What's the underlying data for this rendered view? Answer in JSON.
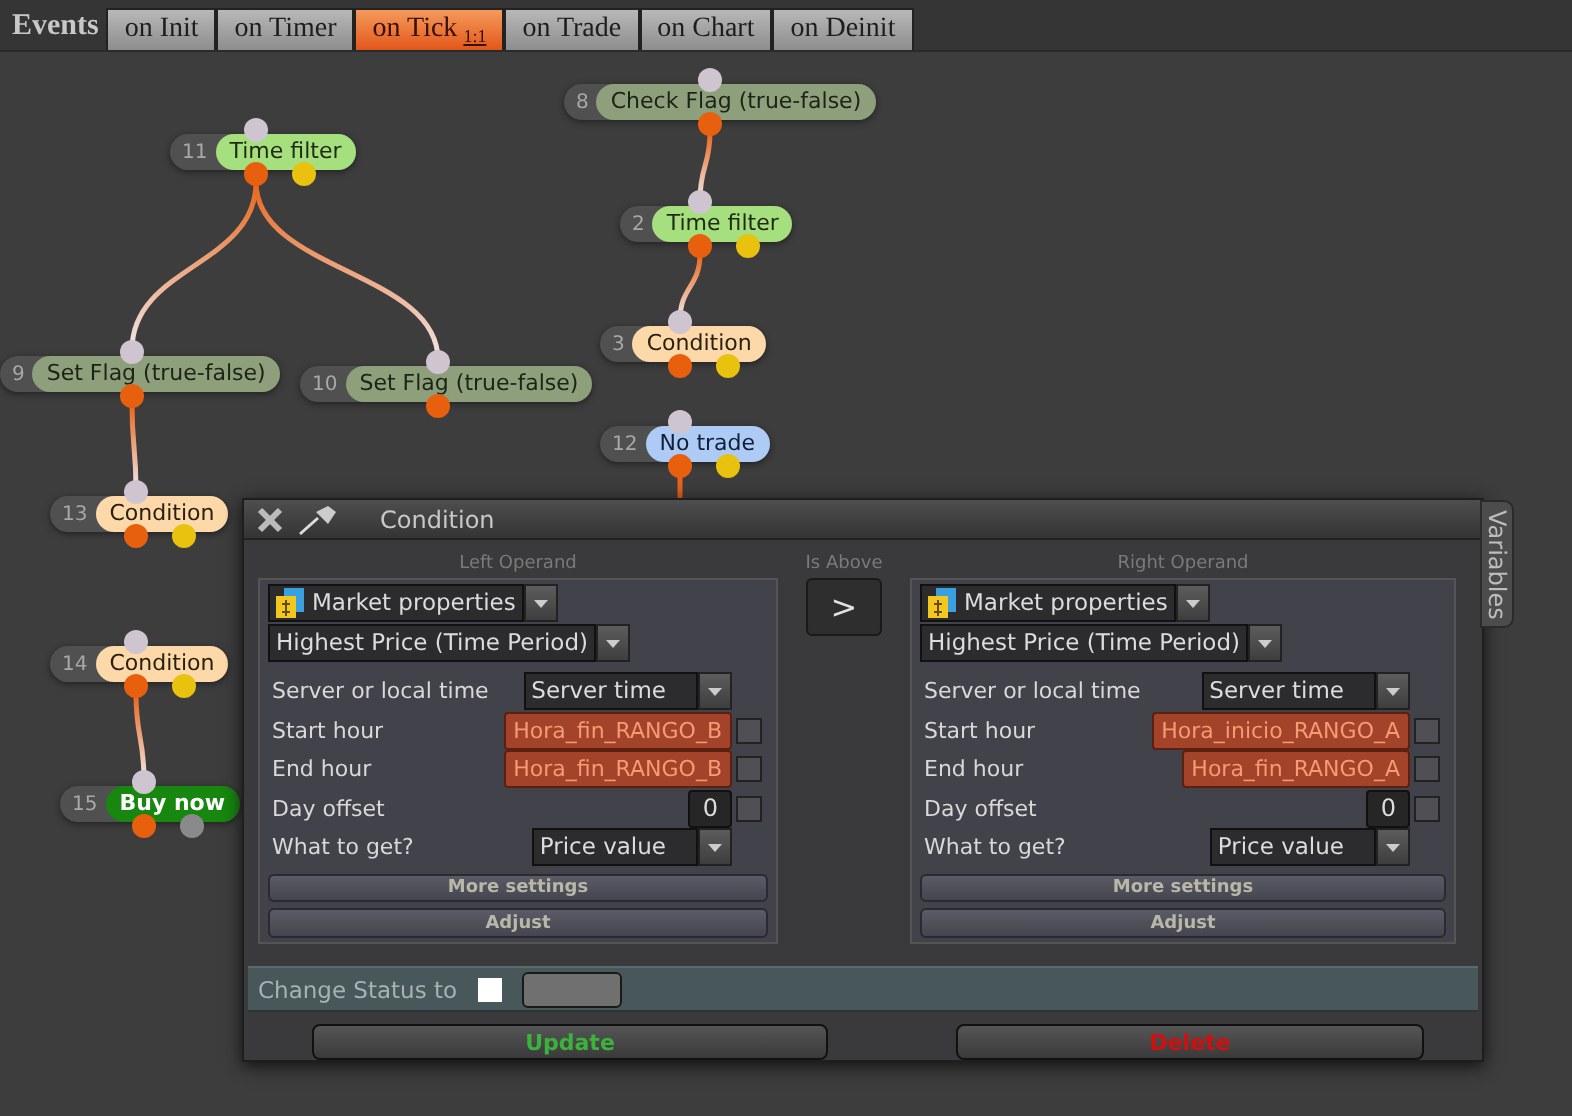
{
  "events": {
    "label": "Events",
    "tabs": [
      {
        "label": "on Init",
        "selected": false
      },
      {
        "label": "on Timer",
        "selected": false
      },
      {
        "label": "on Tick",
        "selected": true,
        "badge": "1:1"
      },
      {
        "label": "on Trade",
        "selected": false
      },
      {
        "label": "on Chart",
        "selected": false
      },
      {
        "label": "on Deinit",
        "selected": false
      }
    ]
  },
  "nodes": [
    {
      "number": "11",
      "label": "Time filter",
      "kind": "filter"
    },
    {
      "number": "8",
      "label": "Check Flag (true-false)",
      "kind": "flag"
    },
    {
      "number": "2",
      "label": "Time filter",
      "kind": "filter"
    },
    {
      "number": "3",
      "label": "Condition",
      "kind": "condition"
    },
    {
      "number": "12",
      "label": "No trade",
      "kind": "notrade"
    },
    {
      "number": "9",
      "label": "Set Flag (true-false)",
      "kind": "flag"
    },
    {
      "number": "10",
      "label": "Set Flag (true-false)",
      "kind": "flag"
    },
    {
      "number": "13",
      "label": "Condition",
      "kind": "condition"
    },
    {
      "number": "14",
      "label": "Condition",
      "kind": "condition"
    },
    {
      "number": "15",
      "label": "Buy now",
      "kind": "action"
    }
  ],
  "dialog": {
    "title": "Condition",
    "operator": {
      "caption": "Is Above",
      "symbol": ">"
    },
    "operands": [
      {
        "caption": "Left Operand",
        "category": "Market properties",
        "function": "Highest Price (Time Period)",
        "params": [
          {
            "label": "Server or local time",
            "kind": "select",
            "value": "Server time"
          },
          {
            "label": "Start hour",
            "kind": "variable",
            "value": "Hora_fin_RANGO_B",
            "checked": false
          },
          {
            "label": "End hour",
            "kind": "variable",
            "value": "Hora_fin_RANGO_B",
            "checked": false
          },
          {
            "label": "Day offset",
            "kind": "number",
            "value": "0",
            "checked": false
          },
          {
            "label": "What to get?",
            "kind": "select",
            "value": "Price value"
          }
        ],
        "buttons": [
          "More settings",
          "Adjust"
        ]
      },
      {
        "caption": "Right Operand",
        "category": "Market properties",
        "function": "Highest Price (Time Period)",
        "params": [
          {
            "label": "Server or local time",
            "kind": "select",
            "value": "Server time"
          },
          {
            "label": "Start hour",
            "kind": "variable",
            "value": "Hora_inicio_RANGO_A",
            "checked": false
          },
          {
            "label": "End hour",
            "kind": "variable",
            "value": "Hora_fin_RANGO_A",
            "checked": false
          },
          {
            "label": "Day offset",
            "kind": "number",
            "value": "0",
            "checked": false
          },
          {
            "label": "What to get?",
            "kind": "select",
            "value": "Price value"
          }
        ],
        "buttons": [
          "More settings",
          "Adjust"
        ]
      }
    ],
    "change_status": {
      "label": "Change Status to",
      "checked": false
    },
    "actions": [
      {
        "label": "Update",
        "kind": "update"
      },
      {
        "label": "Delete",
        "kind": "delete"
      }
    ]
  },
  "side_tab": "Variables"
}
